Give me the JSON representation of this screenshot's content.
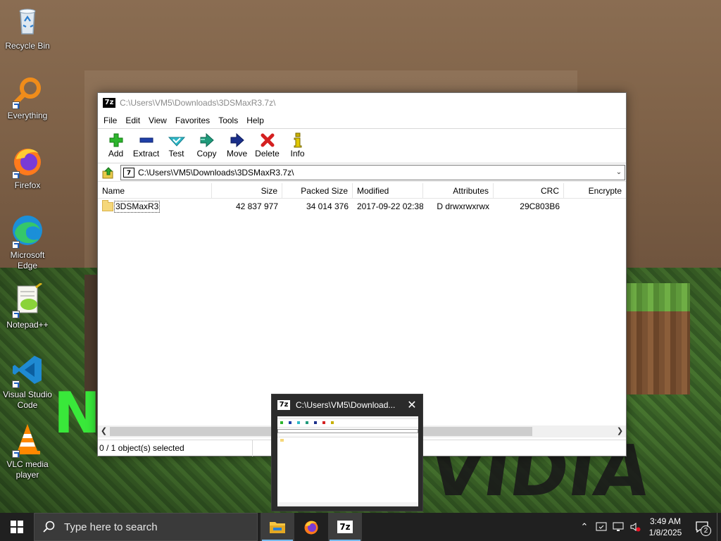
{
  "desktop": {
    "icons": [
      {
        "label": "Recycle Bin"
      },
      {
        "label": "Everything"
      },
      {
        "label": "Firefox"
      },
      {
        "label": "Microsoft Edge"
      },
      {
        "label": "Notepad++"
      },
      {
        "label": "Visual Studio Code"
      },
      {
        "label": "VLC media player"
      }
    ],
    "wallpaper_text": {
      "green": "N",
      "dark": "VIDIA"
    }
  },
  "window": {
    "app_icon": "7z",
    "title": "C:\\Users\\VM5\\Downloads\\3DSMaxR3.7z\\",
    "menu": [
      "File",
      "Edit",
      "View",
      "Favorites",
      "Tools",
      "Help"
    ],
    "toolbar": [
      {
        "label": "Add",
        "icon": "plus-icon",
        "color": "#2db52d"
      },
      {
        "label": "Extract",
        "icon": "minus-icon",
        "color": "#1f3fa8"
      },
      {
        "label": "Test",
        "icon": "check-icon",
        "color": "#2fb8c8"
      },
      {
        "label": "Copy",
        "icon": "double-arrow-icon",
        "color": "#1f9a7a"
      },
      {
        "label": "Move",
        "icon": "arrow-right-icon",
        "color": "#1a2f8a"
      },
      {
        "label": "Delete",
        "icon": "x-icon",
        "color": "#d42020"
      },
      {
        "label": "Info",
        "icon": "info-icon",
        "color": "#c8b000"
      }
    ],
    "address": "C:\\Users\\VM5\\Downloads\\3DSMaxR3.7z\\",
    "columns": [
      "Name",
      "Size",
      "Packed Size",
      "Modified",
      "Attributes",
      "CRC",
      "Encrypte"
    ],
    "rows": [
      {
        "name": "3DSMaxR3",
        "size": "42 837 977",
        "packed": "34 014 376",
        "modified": "2017-09-22 02:38",
        "attributes": "D drwxrwxrwx",
        "crc": "29C803B6",
        "encrypted": ""
      }
    ],
    "status": "0 / 1 object(s) selected"
  },
  "thumbnail": {
    "title": "C:\\Users\\VM5\\Download..."
  },
  "taskbar": {
    "search_placeholder": "Type here to search",
    "apps": [
      "File Explorer",
      "Firefox",
      "7-Zip"
    ],
    "time": "3:49 AM",
    "date": "1/8/2025",
    "notification_count": "2"
  }
}
